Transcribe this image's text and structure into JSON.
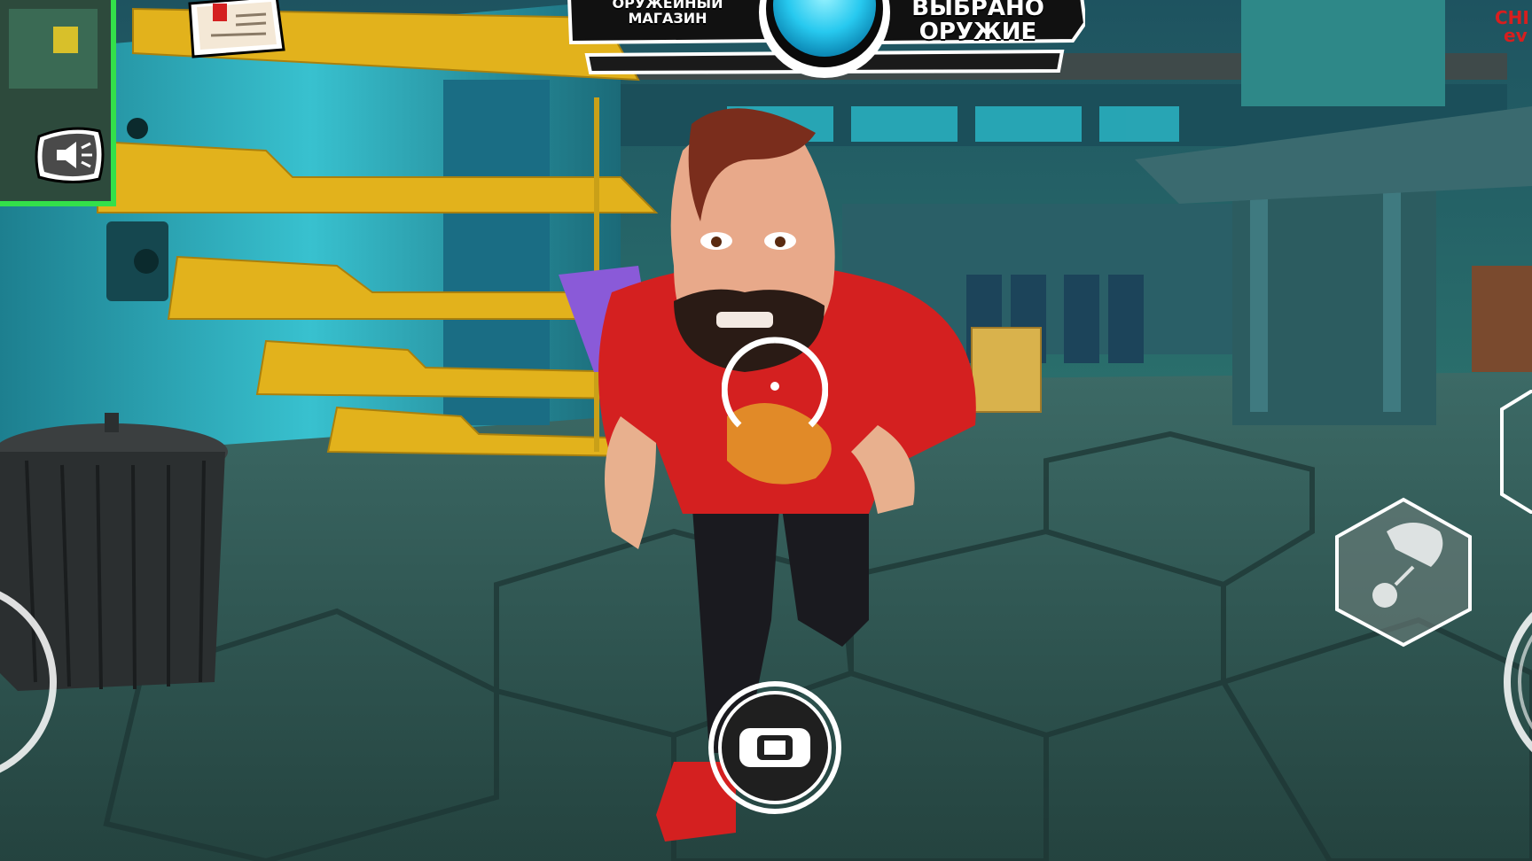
{
  "hud": {
    "shop_label_line1": "ОРУЖЕЙНЫЙ",
    "shop_label_line2": "МАГАЗИН",
    "weapon_label_line1": "ВЫБРАНО",
    "weapon_label_line2": "ОРУЖИЕ",
    "event_badge_text": "CHI ev",
    "event_badge_line1": "CHI",
    "event_badge_line2": "ev"
  },
  "icons": {
    "sound": "speaker-muted-icon",
    "note": "document-note-icon",
    "crosshair": "crosshair-icon",
    "grab": "grab-hand-icon",
    "throw": "throw-hand-icon",
    "minimap": "minimap-icon"
  },
  "colors": {
    "floor": "#2f5a55",
    "wall": "#2aa6b8",
    "shelf": "#e2b21c",
    "shirt": "#d42020",
    "hud_white": "#ffffff",
    "orb": "#27c9ef"
  }
}
